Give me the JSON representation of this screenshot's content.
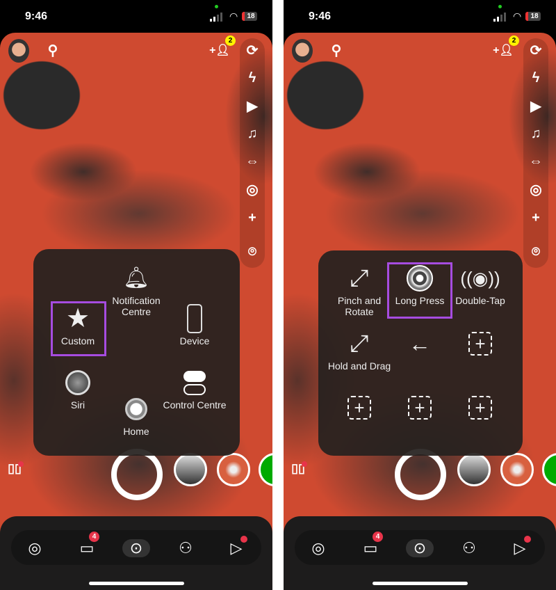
{
  "phones": [
    {
      "status": {
        "time": "9:46",
        "battery": "18"
      },
      "friend_badge": "2",
      "chat_badge": "4",
      "menu": {
        "type": "assistive-touch-main",
        "selected": "Custom",
        "items": [
          {
            "label": "Notification Centre",
            "icon": "bell-icon"
          },
          {
            "label": "Custom",
            "icon": "star-icon"
          },
          {
            "label": "Device",
            "icon": "phone-icon"
          },
          {
            "label": "Siri",
            "icon": "siri-icon"
          },
          {
            "label": "Home",
            "icon": "home-button-icon"
          },
          {
            "label": "Control Centre",
            "icon": "toggles-icon"
          }
        ]
      }
    },
    {
      "status": {
        "time": "9:46",
        "battery": "18"
      },
      "friend_badge": "2",
      "chat_badge": "4",
      "menu": {
        "type": "custom-gestures",
        "selected": "Long Press",
        "items": [
          {
            "label": "Pinch and Rotate",
            "icon": "pinch-rotate-icon"
          },
          {
            "label": "Long Press",
            "icon": "long-press-icon"
          },
          {
            "label": "Double-Tap",
            "icon": "double-tap-icon"
          },
          {
            "label": "Hold and Drag",
            "icon": "hold-drag-icon"
          },
          {
            "label": "",
            "icon": "back-arrow-icon"
          },
          {
            "label": "",
            "icon": "add-gesture-icon"
          },
          {
            "label": "",
            "icon": "add-gesture-icon"
          },
          {
            "label": "",
            "icon": "add-gesture-icon"
          },
          {
            "label": "",
            "icon": "add-gesture-icon"
          }
        ]
      }
    }
  ],
  "colors": {
    "highlight": "#a64ce0",
    "badge_red": "#e8344a",
    "badge_yellow": "#fff200",
    "camera_bg": "#cf4a30"
  }
}
